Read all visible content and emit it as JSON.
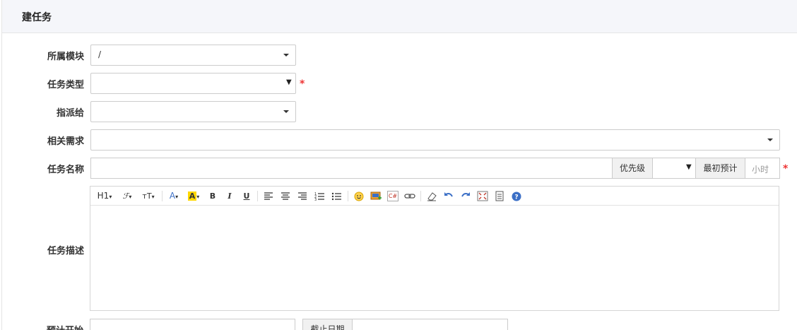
{
  "header": {
    "title": "建任务"
  },
  "form": {
    "module": {
      "label": "所属模块",
      "value": "/"
    },
    "type": {
      "label": "任务类型",
      "value": "",
      "required": "*"
    },
    "assignee": {
      "label": "指派给",
      "value": ""
    },
    "story": {
      "label": "相关需求",
      "value": ""
    },
    "name": {
      "label": "任务名称",
      "value": "",
      "priority_label": "优先级",
      "priority_value": "",
      "estimate_label": "最初预计",
      "estimate_placeholder": "小时",
      "required": "*"
    },
    "description": {
      "label": "任务描述",
      "value": ""
    },
    "start": {
      "label": "预计开始",
      "value": ""
    },
    "deadline": {
      "label": "截止日期",
      "value": ""
    }
  },
  "toolbar": {
    "heading": "H1",
    "font_family": "ℱ",
    "font_size": "тT",
    "font_color": "A",
    "highlight": "A",
    "bold": "B",
    "italic": "I",
    "underline": "U",
    "code": "C#",
    "help": "?"
  },
  "colors": {
    "required": "#e33333",
    "highlight": "#ffd800",
    "font_color": "#3b6fc6",
    "header_bg": "#f5f6fa"
  }
}
